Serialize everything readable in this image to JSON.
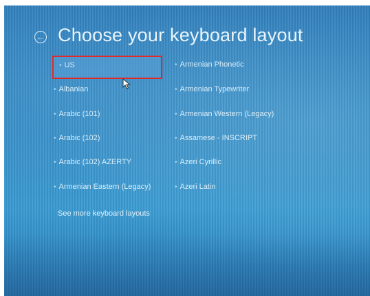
{
  "header": {
    "title": "Choose your keyboard layout",
    "back_icon": "back-arrow-circle-icon"
  },
  "layouts": {
    "col1": [
      "US",
      "Albanian",
      "Arabic (101)",
      "Arabic (102)",
      "Arabic (102) AZERTY",
      "Armenian Eastern (Legacy)"
    ],
    "col2": [
      "Armenian Phonetic",
      "Armenian Typewriter",
      "Armenian Western (Legacy)",
      "Assamese - INSCRIPT",
      "Azeri Cyrillic",
      "Azeri Latin"
    ],
    "selected": "US"
  },
  "more_link": "See more keyboard layouts",
  "colors": {
    "background": "#2e86c2",
    "text": "#d9eef9",
    "selection_outline": "#e02a2a"
  }
}
